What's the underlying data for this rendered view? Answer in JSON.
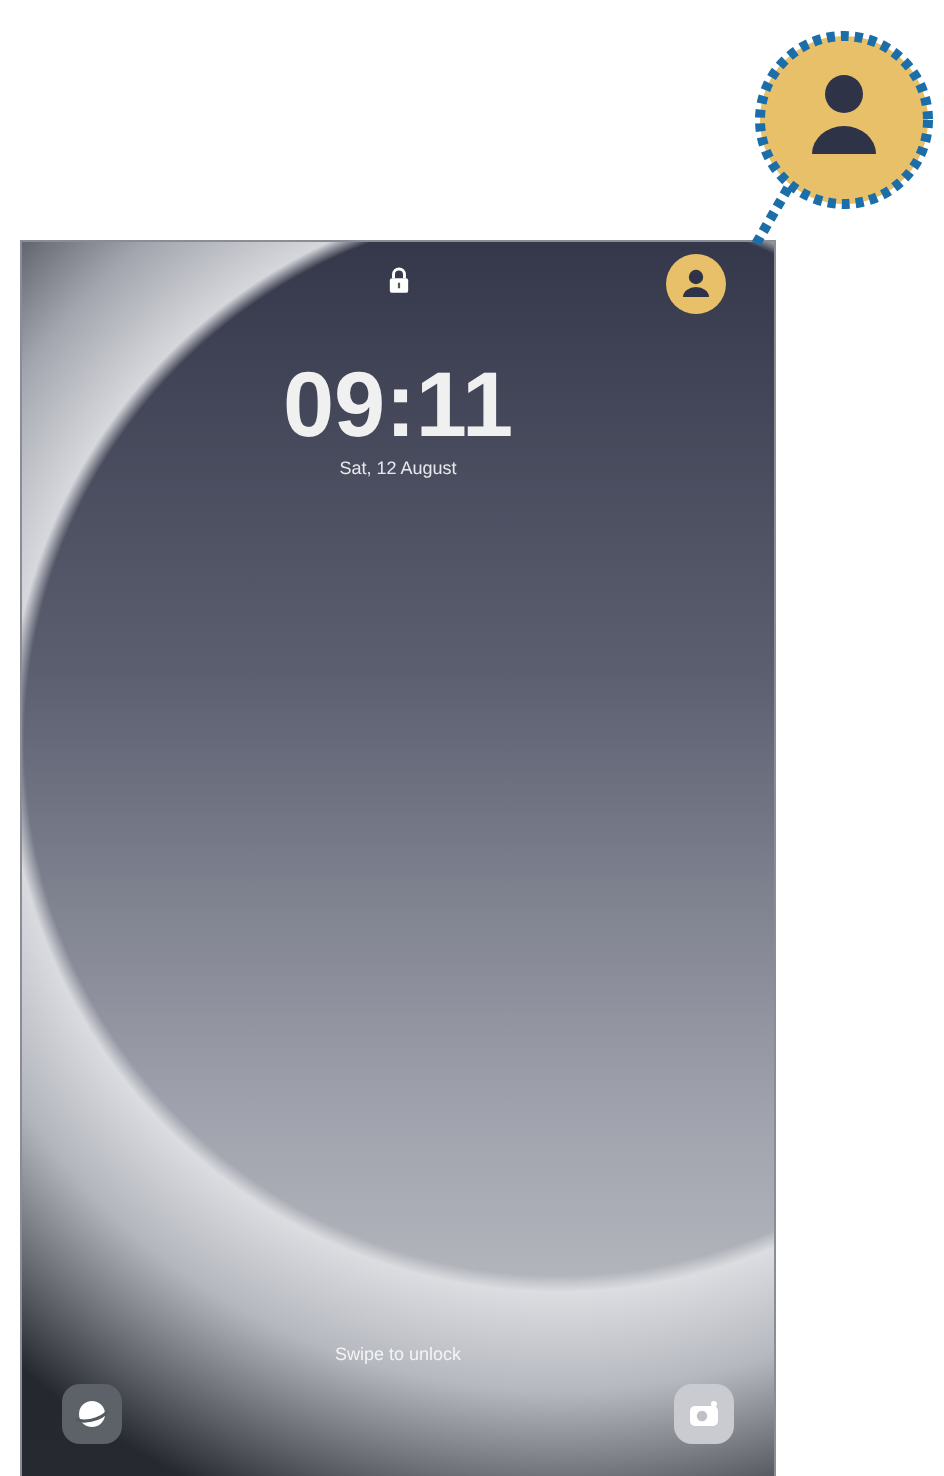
{
  "lock_screen": {
    "time": "09:11",
    "date": "Sat, 12 August",
    "hint": "Swipe to unlock"
  }
}
